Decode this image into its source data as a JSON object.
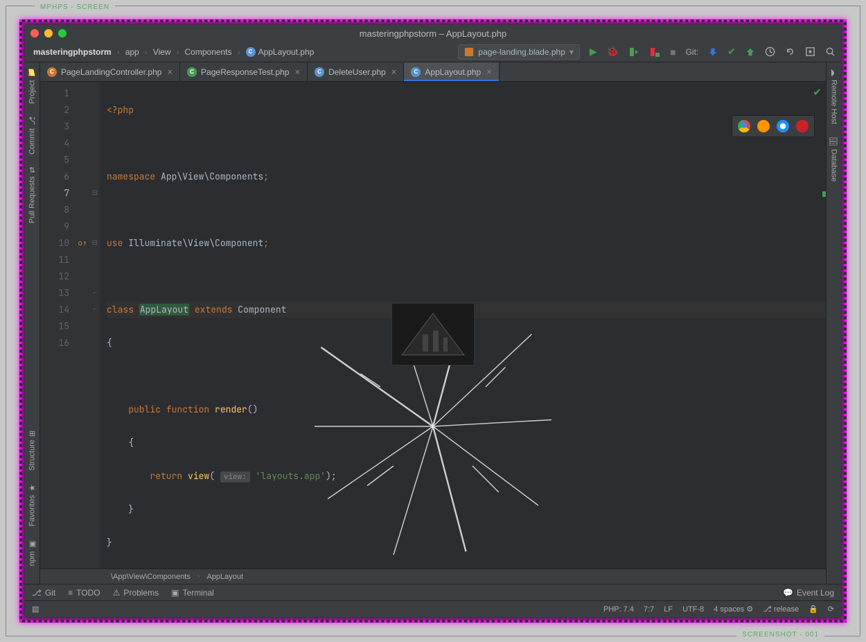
{
  "frame": {
    "top_label": "MPHPS - SCREEN",
    "bottom_label": "SCREENSHOT - 001"
  },
  "window": {
    "title": "masteringphpstorm – AppLayout.php"
  },
  "breadcrumb": {
    "project": "masteringphpstorm",
    "parts": [
      "app",
      "View",
      "Components",
      "AppLayout.php"
    ]
  },
  "run_config": {
    "label": "page-landing.blade.php"
  },
  "git_label": "Git:",
  "tabs": [
    {
      "label": "PageLandingController.php",
      "icon": "orange",
      "active": false
    },
    {
      "label": "PageResponseTest.php",
      "icon": "green",
      "active": false
    },
    {
      "label": "DeleteUser.php",
      "icon": "blue",
      "active": false
    },
    {
      "label": "AppLayout.php",
      "icon": "blue",
      "active": true
    }
  ],
  "left_tools": [
    {
      "label": "Project",
      "icon": "folder"
    },
    {
      "label": "Commit",
      "icon": "commit"
    },
    {
      "label": "Pull Requests",
      "icon": "pull-request"
    },
    {
      "label": "Structure",
      "icon": "structure"
    },
    {
      "label": "Favorites",
      "icon": "star"
    },
    {
      "label": "npm",
      "icon": "npm"
    }
  ],
  "right_tools": [
    {
      "label": "Remote Host",
      "icon": "remote"
    },
    {
      "label": "Database",
      "icon": "database"
    }
  ],
  "gutter_lines": [
    "1",
    "2",
    "3",
    "4",
    "5",
    "6",
    "7",
    "8",
    "9",
    "10",
    "11",
    "12",
    "13",
    "14",
    "15",
    "16"
  ],
  "code": {
    "l1_open": "<?php",
    "l3_kw": "namespace",
    "l3_body": "App\\View\\Components",
    "l3_semi": ";",
    "l5_kw": "use",
    "l5_body": "Illuminate\\View\\Component",
    "l5_semi": ";",
    "l7_kw1": "class",
    "l7_name": "AppLayout",
    "l7_kw2": "extends",
    "l7_parent": "Component",
    "l8": "{",
    "l10_kw1": "public",
    "l10_kw2": "function",
    "l10_name": "render",
    "l10_paren": "()",
    "l11": "    {",
    "l12_kw": "return",
    "l12_fn": "view",
    "l12_open": "(",
    "l12_hint": "view:",
    "l12_str": "'layouts.app'",
    "l12_close": ");",
    "l13": "    }",
    "l14": "}"
  },
  "editor_breadcrumb": {
    "ns": "\\App\\View\\Components",
    "cls": "AppLayout"
  },
  "bottom_tools": [
    {
      "label": "Git",
      "icon": "branch"
    },
    {
      "label": "TODO",
      "icon": "list"
    },
    {
      "label": "Problems",
      "icon": "warning"
    },
    {
      "label": "Terminal",
      "icon": "terminal"
    }
  ],
  "bottom_right": {
    "event_log": "Event Log"
  },
  "status": {
    "php": "PHP: 7.4",
    "caret": "7:7",
    "eol": "LF",
    "encoding": "UTF-8",
    "indent": "4 spaces",
    "branch": "release"
  }
}
